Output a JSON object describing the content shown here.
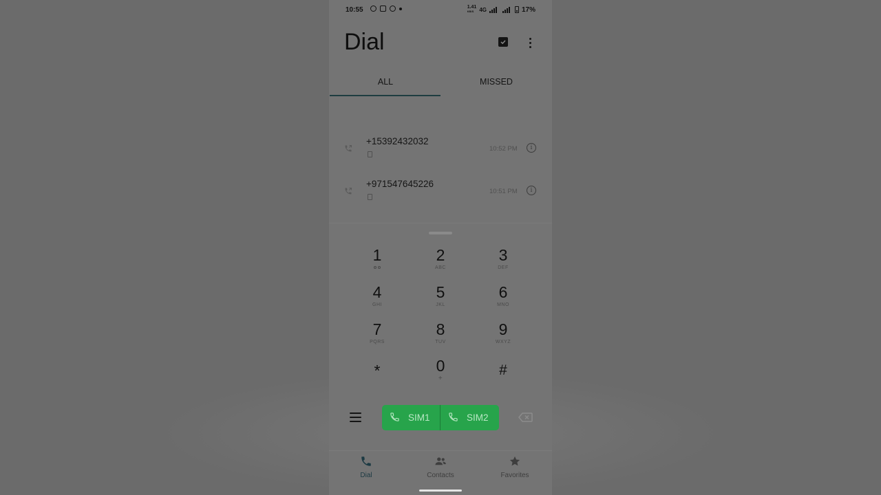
{
  "status_bar": {
    "time": "10:55",
    "network": "4G",
    "battery": "17%",
    "notification_icons": [
      "whatsapp-icon",
      "image-icon",
      "messenger-icon",
      "dot-icon"
    ],
    "right_icons": [
      "data-speed-icon",
      "signal-icon",
      "signal-icon",
      "battery-icon"
    ],
    "data_speed": "1.41",
    "data_speed_unit": "KB/S"
  },
  "header": {
    "title": "Dial",
    "actions": [
      "checkbox-icon",
      "more-vert-icon"
    ]
  },
  "tabs": [
    {
      "label": "ALL",
      "selected": true
    },
    {
      "label": "MISSED",
      "selected": false
    }
  ],
  "call_log": [
    {
      "number": "+15392432032",
      "time": "10:52 PM"
    },
    {
      "number": "+971547645226",
      "time": "10:51 PM"
    }
  ],
  "dialpad": {
    "keys": [
      {
        "digit": "1",
        "sub": ""
      },
      {
        "digit": "2",
        "sub": "ABC"
      },
      {
        "digit": "3",
        "sub": "DEF"
      },
      {
        "digit": "4",
        "sub": "GHI"
      },
      {
        "digit": "5",
        "sub": "JKL"
      },
      {
        "digit": "6",
        "sub": "MNO"
      },
      {
        "digit": "7",
        "sub": "PQRS"
      },
      {
        "digit": "8",
        "sub": "TUV"
      },
      {
        "digit": "9",
        "sub": "WXYZ"
      },
      {
        "digit": "*",
        "sub": ""
      },
      {
        "digit": "0",
        "sub": "+"
      },
      {
        "digit": "#",
        "sub": ""
      }
    ]
  },
  "actions": {
    "sim1_label": "SIM1",
    "sim2_label": "SIM2"
  },
  "bottom_nav": [
    {
      "label": "Dial",
      "icon": "phone-icon",
      "selected": true
    },
    {
      "label": "Contacts",
      "icon": "contacts-icon",
      "selected": false
    },
    {
      "label": "Favorites",
      "icon": "star-icon",
      "selected": false
    }
  ],
  "colors": {
    "background": "#6b6b6b",
    "screen": "#747474",
    "call_button": "#27a44b",
    "accent": "#1e3d41"
  }
}
